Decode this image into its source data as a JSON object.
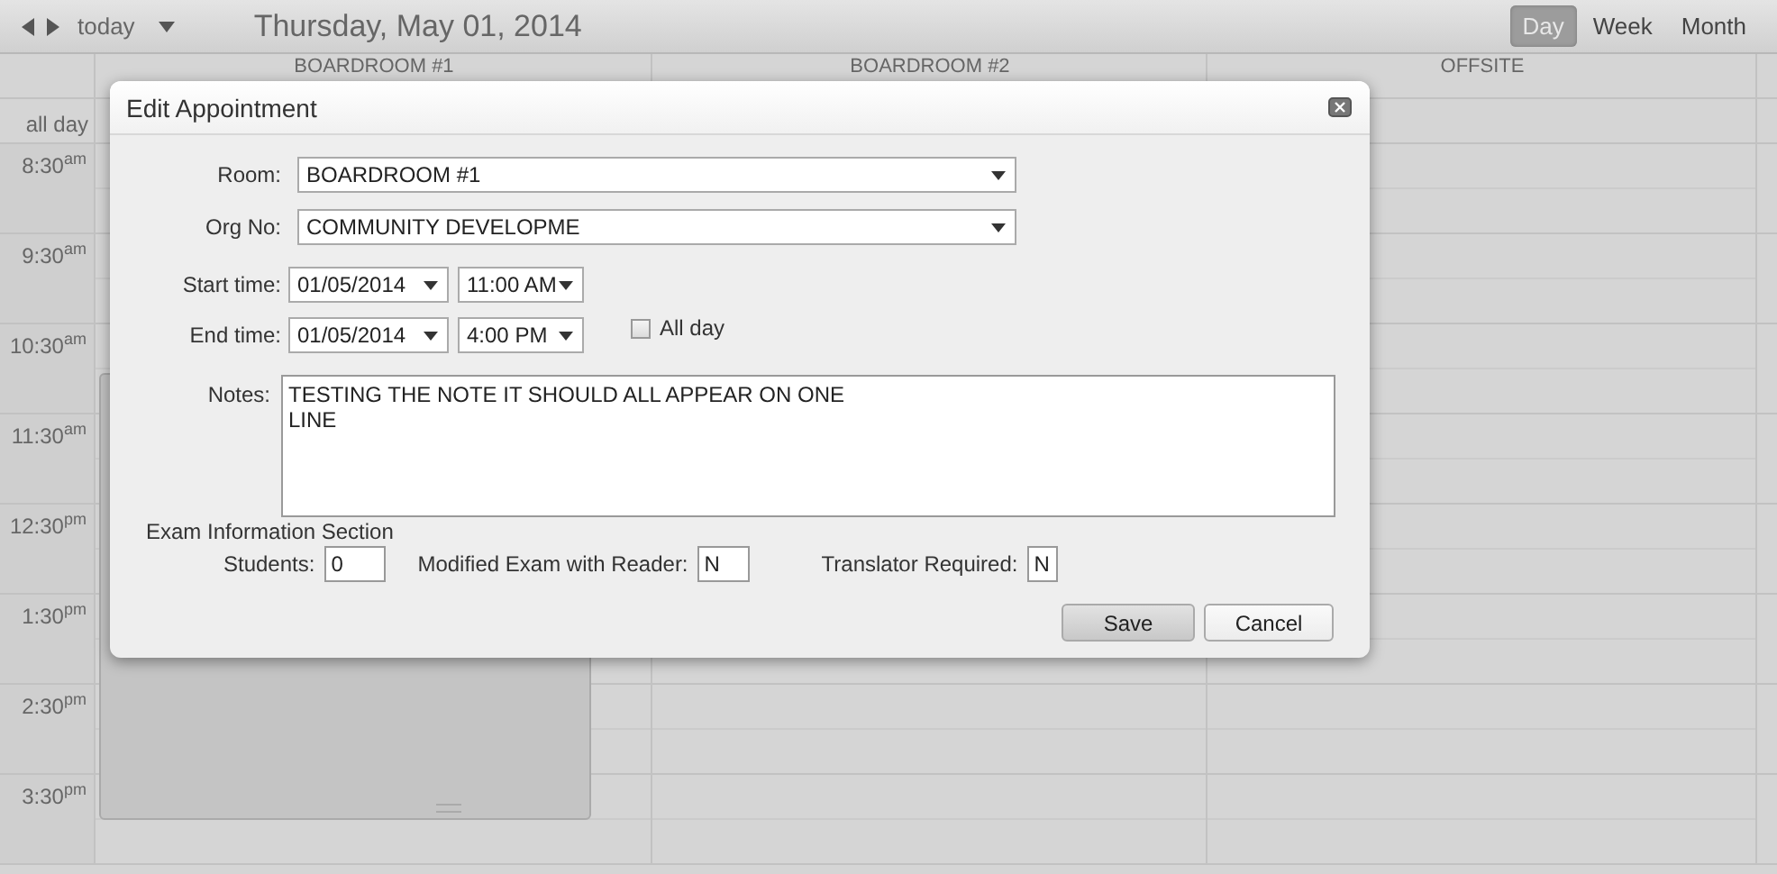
{
  "toolbar": {
    "today_label": "today",
    "date_title": "Thursday, May 01, 2014",
    "views": [
      {
        "label": "Day",
        "selected": true
      },
      {
        "label": "Week",
        "selected": false
      },
      {
        "label": "Month",
        "selected": false
      }
    ]
  },
  "calendar": {
    "columns": [
      "BOARDROOM #1",
      "BOARDROOM #2",
      "OFFSITE"
    ],
    "all_day_label": "all day",
    "times": [
      "8:30$^{am}$",
      "9:30$^{am}$",
      "10:30$^{am}$",
      "11:30$^{am}$",
      "12:30$^{pm}$",
      "1:30$^{pm}$",
      "2:30$^{pm}$",
      "3:30$^{pm}$"
    ]
  },
  "dialog": {
    "title": "Edit Appointment",
    "room": {
      "label": "Room:",
      "value": "BOARDROOM #1"
    },
    "org_no": {
      "label": "Org No:",
      "value": "COMMUNITY DEVELOPME"
    },
    "start_time": {
      "label": "Start time:",
      "date": "01/05/2014",
      "time": "11:00 AM"
    },
    "end_time": {
      "label": "End time:",
      "date": "01/05/2014",
      "time": "4:00 PM"
    },
    "all_day": {
      "label": "All day",
      "checked": false
    },
    "notes": {
      "label": "Notes:",
      "value": "TESTING THE NOTE IT SHOULD ALL APPEAR ON ONE\nLINE"
    },
    "exam_section": {
      "title": "Exam Information Section",
      "fields": [
        {
          "label": "Students:",
          "value": "0"
        },
        {
          "label": "Modified Exam with Reader:",
          "value": "N"
        },
        {
          "label": "Translator Required:",
          "value": "N"
        }
      ]
    },
    "buttons": [
      {
        "label": "Save",
        "kind": "primary"
      },
      {
        "label": "Cancel",
        "kind": "secondary"
      }
    ]
  }
}
